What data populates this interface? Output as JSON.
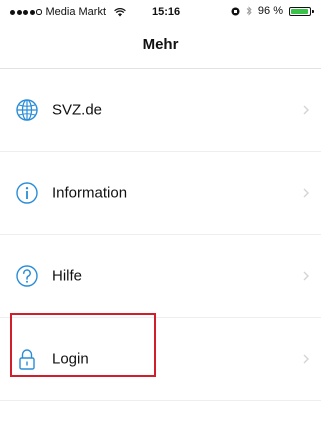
{
  "status_bar": {
    "carrier": "Media Markt",
    "time": "15:16",
    "battery": "96 %",
    "battery_level": 0.96
  },
  "nav": {
    "title": "Mehr"
  },
  "menu": {
    "items": [
      {
        "label": "SVZ.de",
        "icon": "globe-icon"
      },
      {
        "label": "Information",
        "icon": "info-icon"
      },
      {
        "label": "Hilfe",
        "icon": "help-icon"
      },
      {
        "label": "Login",
        "icon": "lock-icon"
      }
    ]
  },
  "colors": {
    "accent": "#2a8dd8",
    "highlight": "#d01f2a",
    "battery": "#39c24a"
  }
}
